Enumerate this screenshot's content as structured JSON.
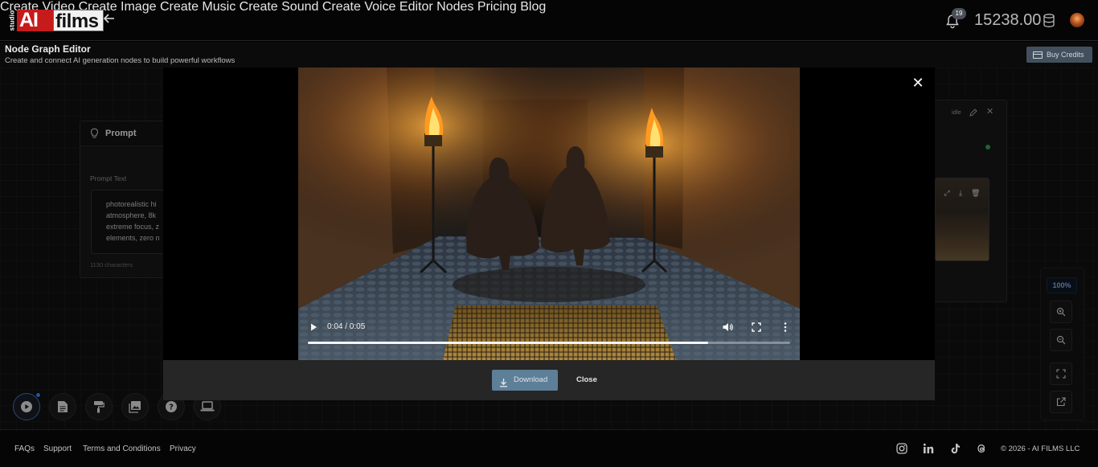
{
  "brand": {
    "logo_studio": "studio",
    "logo_ai": "AI",
    "logo_films": "films"
  },
  "nav": {
    "items": [
      "Create Video",
      "Create Image",
      "Create Music",
      "Create Sound",
      "Create Voice",
      "Editor",
      "Nodes",
      "Pricing",
      "Blog"
    ],
    "notification_count": "19",
    "credits": "15238.00"
  },
  "editor": {
    "title": "Node Graph Editor",
    "subtitle": "Create and connect AI generation nodes to build powerful workflows",
    "buy_credits": "Buy Credits"
  },
  "prompt_node": {
    "title": "Prompt",
    "field_label": "Prompt Text",
    "text": "photorealistic hi\natmosphere, 8k\nextreme focus, z\nelements, zero n",
    "char_count": "1130 characters"
  },
  "right_node": {
    "status": "idle"
  },
  "zoom": {
    "level": "100%"
  },
  "video": {
    "time": "0:04 / 0:05",
    "progress": 0.83
  },
  "modal": {
    "download": "Download",
    "close": "Close"
  },
  "footer": {
    "links": [
      "FAQs",
      "Support",
      "Terms and Conditions",
      "Privacy"
    ],
    "copyright": "© 2026 - AI FILMS LLC"
  },
  "colors": {
    "accent_blue": "#3b82f6",
    "logo_red": "#c51b1b",
    "download_button": "#5d7f97",
    "status_green": "#2f9a5b"
  }
}
